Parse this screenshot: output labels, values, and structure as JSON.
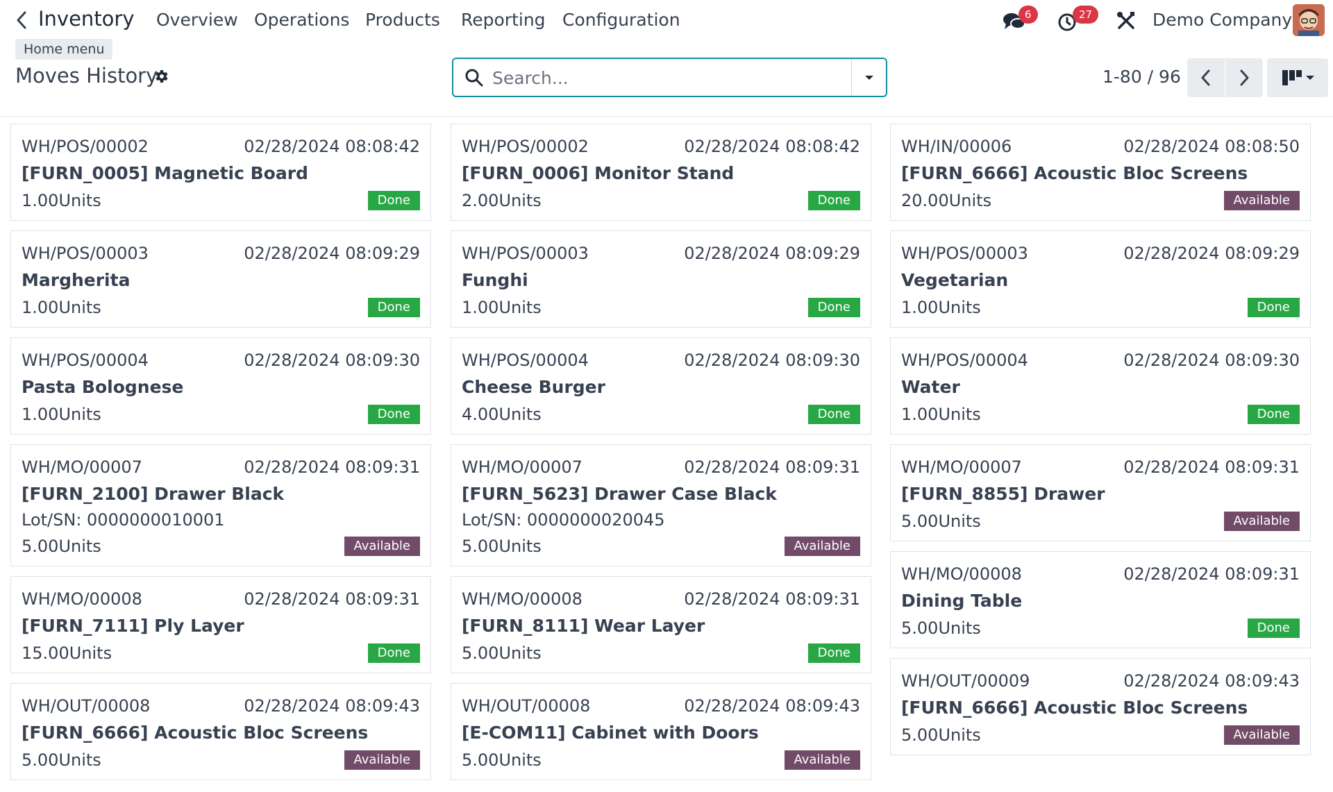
{
  "navbar": {
    "app_title": "Inventory",
    "menu": [
      "Overview",
      "Operations",
      "Products",
      "Reporting",
      "Configuration"
    ],
    "tooltip": "Home menu",
    "messages_count": "6",
    "activities_count": "27",
    "company": "Demo Company"
  },
  "control": {
    "page_title": "Moves History",
    "search_placeholder": "Search...",
    "pager": "1-80 / 96"
  },
  "colors": {
    "done": "#28a745",
    "available": "#714b67",
    "accent": "#0e8fa0"
  },
  "cards": [
    {
      "ref": "WH/POS/00002",
      "date": "02/28/2024 08:08:42",
      "product": "[FURN_0005] Magnetic Board",
      "lot": "",
      "qty": "1.00Units",
      "status": "Done"
    },
    {
      "ref": "WH/POS/00002",
      "date": "02/28/2024 08:08:42",
      "product": "[FURN_0006] Monitor Stand",
      "lot": "",
      "qty": "2.00Units",
      "status": "Done"
    },
    {
      "ref": "WH/IN/00006",
      "date": "02/28/2024 08:08:50",
      "product": "[FURN_6666] Acoustic Bloc Screens",
      "lot": "",
      "qty": "20.00Units",
      "status": "Available"
    },
    {
      "ref": "WH/POS/00003",
      "date": "02/28/2024 08:09:29",
      "product": "Margherita",
      "lot": "",
      "qty": "1.00Units",
      "status": "Done"
    },
    {
      "ref": "WH/POS/00003",
      "date": "02/28/2024 08:09:29",
      "product": "Funghi",
      "lot": "",
      "qty": "1.00Units",
      "status": "Done"
    },
    {
      "ref": "WH/POS/00003",
      "date": "02/28/2024 08:09:29",
      "product": "Vegetarian",
      "lot": "",
      "qty": "1.00Units",
      "status": "Done"
    },
    {
      "ref": "WH/POS/00004",
      "date": "02/28/2024 08:09:30",
      "product": "Pasta Bolognese",
      "lot": "",
      "qty": "1.00Units",
      "status": "Done"
    },
    {
      "ref": "WH/POS/00004",
      "date": "02/28/2024 08:09:30",
      "product": "Cheese Burger",
      "lot": "",
      "qty": "4.00Units",
      "status": "Done"
    },
    {
      "ref": "WH/POS/00004",
      "date": "02/28/2024 08:09:30",
      "product": "Water",
      "lot": "",
      "qty": "1.00Units",
      "status": "Done"
    },
    {
      "ref": "WH/MO/00007",
      "date": "02/28/2024 08:09:31",
      "product": "[FURN_2100] Drawer Black",
      "lot": "Lot/SN: 0000000010001",
      "qty": "5.00Units",
      "status": "Available"
    },
    {
      "ref": "WH/MO/00007",
      "date": "02/28/2024 08:09:31",
      "product": "[FURN_5623] Drawer Case Black",
      "lot": "Lot/SN: 0000000020045",
      "qty": "5.00Units",
      "status": "Available"
    },
    {
      "ref": "WH/MO/00007",
      "date": "02/28/2024 08:09:31",
      "product": "[FURN_8855] Drawer",
      "lot": "",
      "qty": "5.00Units",
      "status": "Available"
    },
    {
      "ref": "WH/MO/00008",
      "date": "02/28/2024 08:09:31",
      "product": "[FURN_7111] Ply Layer",
      "lot": "",
      "qty": "15.00Units",
      "status": "Done"
    },
    {
      "ref": "WH/MO/00008",
      "date": "02/28/2024 08:09:31",
      "product": "[FURN_8111] Wear Layer",
      "lot": "",
      "qty": "5.00Units",
      "status": "Done"
    },
    {
      "ref": "WH/MO/00008",
      "date": "02/28/2024 08:09:31",
      "product": "Dining Table",
      "lot": "",
      "qty": "5.00Units",
      "status": "Done"
    },
    {
      "ref": "WH/OUT/00008",
      "date": "02/28/2024 08:09:43",
      "product": "[FURN_6666] Acoustic Bloc Screens",
      "lot": "",
      "qty": "5.00Units",
      "status": "Available"
    },
    {
      "ref": "WH/OUT/00008",
      "date": "02/28/2024 08:09:43",
      "product": "[E-COM11] Cabinet with Doors",
      "lot": "",
      "qty": "5.00Units",
      "status": "Available"
    },
    {
      "ref": "WH/OUT/00009",
      "date": "02/28/2024 08:09:43",
      "product": "[FURN_6666] Acoustic Bloc Screens",
      "lot": "",
      "qty": "5.00Units",
      "status": "Available"
    }
  ]
}
